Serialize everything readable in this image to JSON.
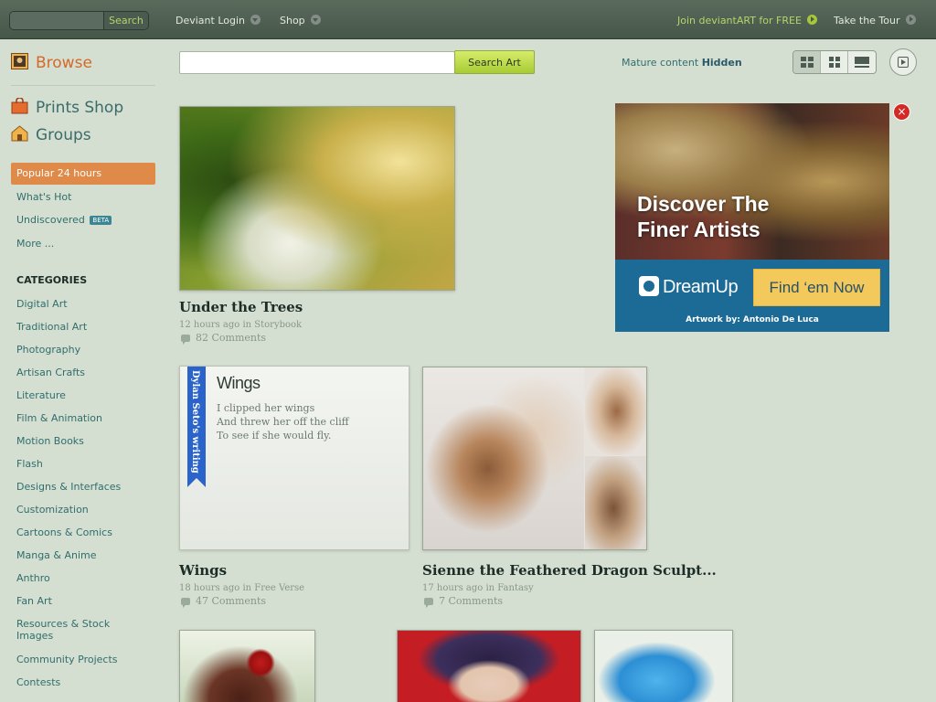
{
  "topbar": {
    "search_placeholder": "",
    "search_button": "Search",
    "deviant_login": "Deviant Login",
    "shop": "Shop",
    "join": "Join deviantART for FREE",
    "tour": "Take the Tour"
  },
  "sidebar": {
    "browse": "Browse",
    "prints_shop": "Prints Shop",
    "groups": "Groups",
    "popular": "Popular 24 hours",
    "whats_hot": "What's Hot",
    "undiscovered": "Undiscovered",
    "beta": "BETA",
    "more": "More ...",
    "categories_heading": "CATEGORIES",
    "categories": [
      "Digital Art",
      "Traditional Art",
      "Photography",
      "Artisan Crafts",
      "Literature",
      "Film & Animation",
      "Motion Books",
      "Flash",
      "Designs & Interfaces",
      "Customization",
      "Cartoons & Comics",
      "Manga & Anime",
      "Anthro",
      "Fan Art",
      "Resources & Stock Images",
      "Community Projects",
      "Contests"
    ]
  },
  "toolbar": {
    "search_button": "Search Art",
    "mature_label": "Mature content",
    "mature_value": "Hidden"
  },
  "deviations": [
    {
      "title": "Under the Trees",
      "meta": "12 hours ago in Storybook",
      "comments": "82 Comments"
    },
    {
      "title": "Wings",
      "meta": "18 hours ago in Free Verse",
      "comments": "47 Comments"
    },
    {
      "title": "Sienne the Feathered Dragon Sculpt...",
      "meta": "17 hours ago in Fantasy",
      "comments": "7 Comments"
    }
  ],
  "literature": {
    "ribbon": "Dylan Seto's writing",
    "title": "Wings",
    "lines": [
      "I clipped her wings",
      "And threw her off the cliff",
      "To see if she would fly."
    ]
  },
  "ad": {
    "headline_1": "Discover The",
    "headline_2": "Finer Artists",
    "brand": "DreamUp",
    "cta": "Find ‘em Now",
    "credit": "Artwork by: Antonio De Luca",
    "close": "×"
  },
  "colors": {
    "accent_orange": "#e08a4a",
    "link_teal": "#2f6e6d",
    "join_green": "#b7d36b",
    "ad_blue": "#1c6a96",
    "ad_yellow": "#f4c95b"
  }
}
